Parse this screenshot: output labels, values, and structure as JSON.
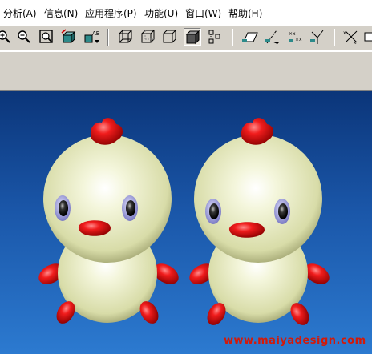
{
  "menu": {
    "items": [
      {
        "label": "分析(A)"
      },
      {
        "label": "信息(N)"
      },
      {
        "label": "应用程序(P)"
      },
      {
        "label": "功能(U)"
      },
      {
        "label": "窗口(W)"
      },
      {
        "label": "帮助(H)"
      }
    ]
  },
  "toolbar": {
    "buttons": [
      {
        "icon": "zoom-in-icon"
      },
      {
        "icon": "zoom-out-icon"
      },
      {
        "icon": "refit-icon"
      },
      {
        "icon": "reorient-icon"
      },
      {
        "icon": "saved-views-icon"
      },
      {
        "icon": "wireframe-icon"
      },
      {
        "icon": "hidden-line-icon"
      },
      {
        "icon": "no-hidden-icon"
      },
      {
        "icon": "shading-icon"
      },
      {
        "icon": "model-tree-icon"
      },
      {
        "icon": "datum-plane-icon"
      },
      {
        "icon": "datum-axis-icon"
      },
      {
        "icon": "datum-point-icon"
      },
      {
        "icon": "coordinate-system-icon"
      },
      {
        "icon": "spin-center-icon"
      }
    ]
  },
  "viewport": {
    "background": [
      "#0b3579",
      "#2c7ad0"
    ],
    "model_color": "#e8ecc4",
    "accent_color": "#e0131b",
    "eye_ring_color": "#9a9ad8"
  },
  "watermark": "www.maiyadesign.com"
}
